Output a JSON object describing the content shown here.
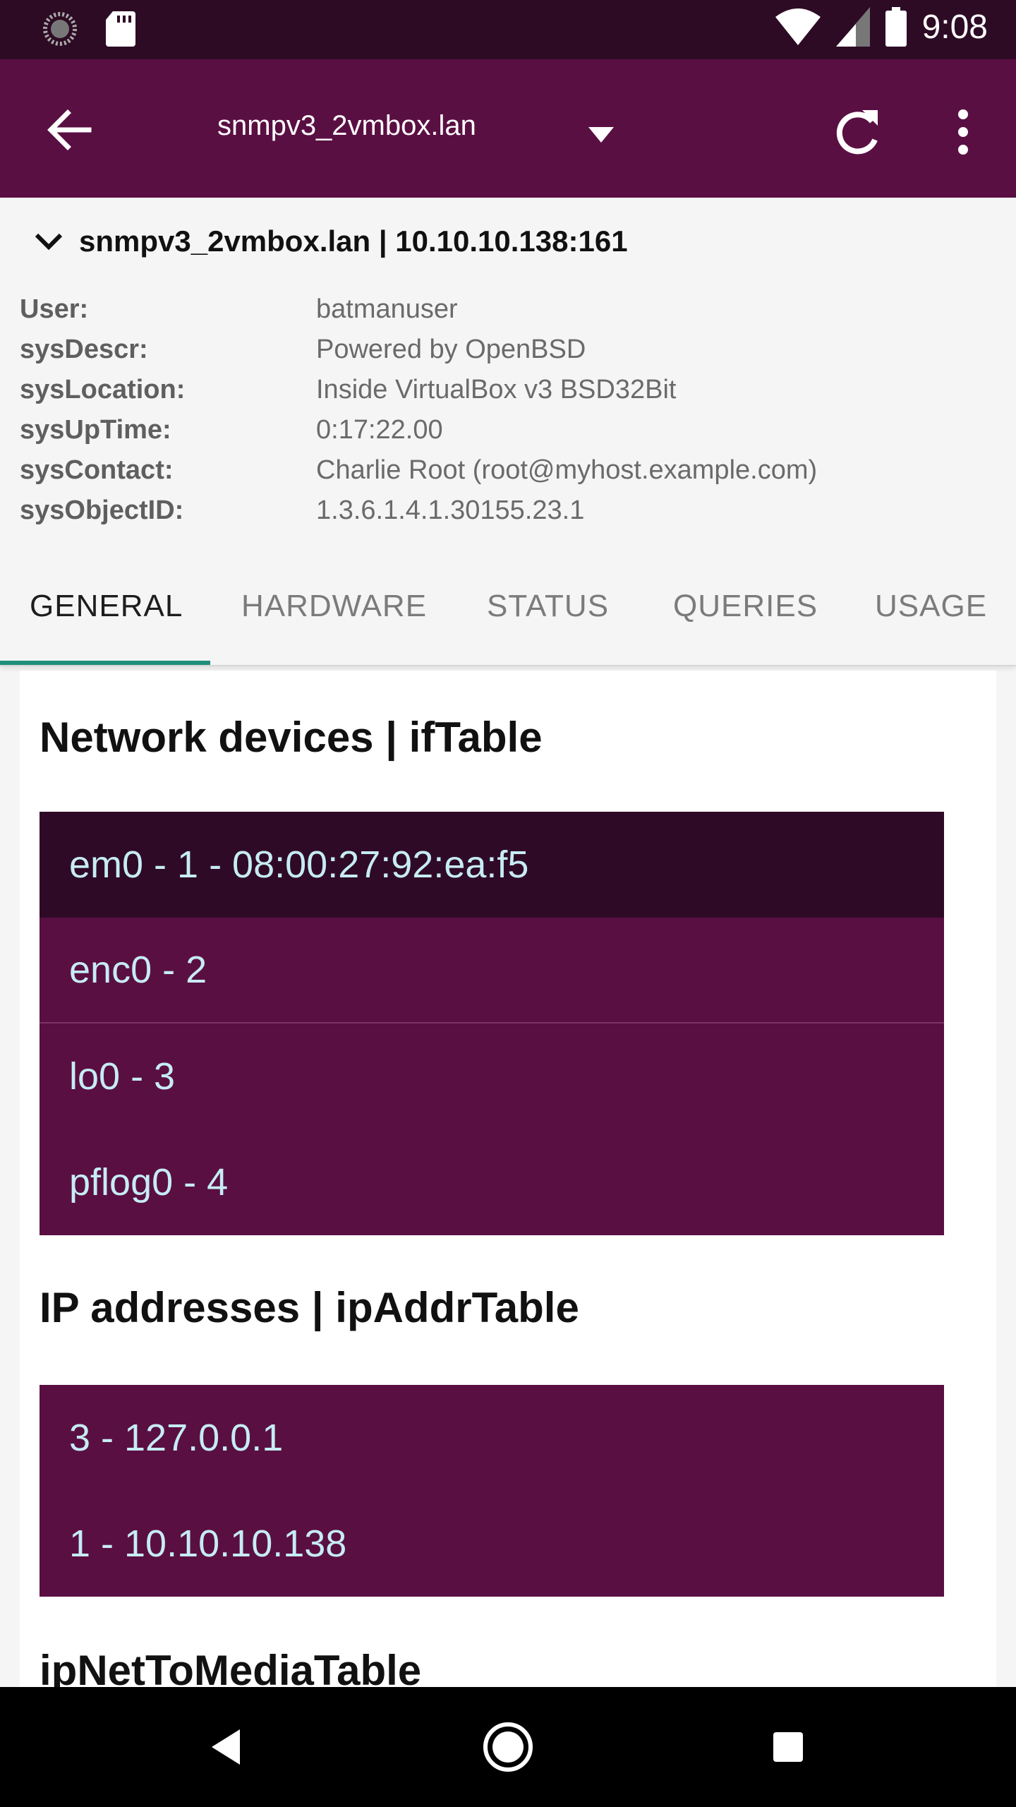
{
  "status_bar": {
    "time": "9:08"
  },
  "app_bar": {
    "title": "snmpv3_2vmbox.lan"
  },
  "device": {
    "header": "snmpv3_2vmbox.lan | 10.10.10.138:161",
    "info": [
      {
        "key": "User:",
        "value": "batmanuser"
      },
      {
        "key": "sysDescr:",
        "value": "Powered by OpenBSD"
      },
      {
        "key": "sysLocation:",
        "value": "Inside VirtualBox v3 BSD32Bit"
      },
      {
        "key": "sysUpTime:",
        "value": "0:17:22.00"
      },
      {
        "key": "sysContact:",
        "value": "Charlie Root (root@myhost.example.com)"
      },
      {
        "key": "sysObjectID:",
        "value": "1.3.6.1.4.1.30155.23.1"
      }
    ]
  },
  "tabs": [
    "GENERAL",
    "HARDWARE",
    "STATUS",
    "QUERIES",
    "USAGE"
  ],
  "active_tab": "GENERAL",
  "sections": {
    "network": {
      "title": "Network devices | ifTable",
      "rows": [
        "em0 - 1 - 08:00:27:92:ea:f5",
        "enc0 - 2",
        "lo0 - 3",
        "pflog0 - 4"
      ]
    },
    "ip": {
      "title": "IP addresses | ipAddrTable",
      "rows": [
        "3 - 127.0.0.1",
        "1 - 10.10.10.138"
      ]
    },
    "arp": {
      "title": "ipNetToMediaTable"
    }
  },
  "colors": {
    "status_bar": "#2e0b24",
    "app_bar": "#5a0f43",
    "row_bg": "#5a0f43",
    "row_selected": "#2f0a26",
    "row_text": "#c6ecf4",
    "tab_indicator": "#1f8f7a"
  }
}
